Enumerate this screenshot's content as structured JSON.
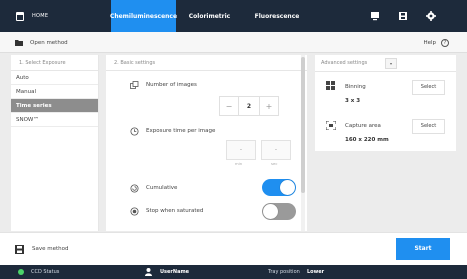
{
  "nav": {
    "home_label": "HOME",
    "tabs": [
      {
        "label": "Chemiluminescence",
        "active": true
      },
      {
        "label": "Colorimetric",
        "active": false
      },
      {
        "label": "Fluorescence",
        "active": false
      }
    ],
    "icons": [
      "monitor-icon",
      "save-icon",
      "settings-icon"
    ],
    "accent_color": "#1f8ff0",
    "bar_color": "#1d2a3b"
  },
  "toolbar": {
    "open_method_label": "Open method",
    "help_label": "Help",
    "help_symbol": "?"
  },
  "exposure": {
    "header": "1. Select Exposure",
    "modes": [
      {
        "label": "Auto",
        "selected": false
      },
      {
        "label": "Manual",
        "selected": false
      },
      {
        "label": "Time series",
        "selected": true
      },
      {
        "label": "SNOW™",
        "selected": false
      }
    ]
  },
  "basic": {
    "header": "2. Basic settings",
    "images_label": "Number of images",
    "images_value": "2",
    "minus": "−",
    "plus": "+",
    "exposure_label": "Exposure time per image",
    "time_placeholder": "-",
    "unit_min": "min",
    "unit_sec": "sec",
    "cumulative_label": "Cumulative",
    "cumulative_on": true,
    "stop_label": "Stop when saturated",
    "stop_on": false
  },
  "advanced": {
    "header": "Advanced settings",
    "dropdown": "▾",
    "binning_label": "Binning",
    "binning_value": "3 x 3",
    "capture_label": "Capture area",
    "capture_value": "160 x 220 mm",
    "select_label": "Select"
  },
  "footer": {
    "save_label": "Save method",
    "start_label": "Start"
  },
  "status": {
    "ccd_label": "CCD Status",
    "ccd_color": "#4cd36a",
    "user_label": "UserName",
    "tray_label": "Tray position",
    "tray_value": "Lower"
  }
}
